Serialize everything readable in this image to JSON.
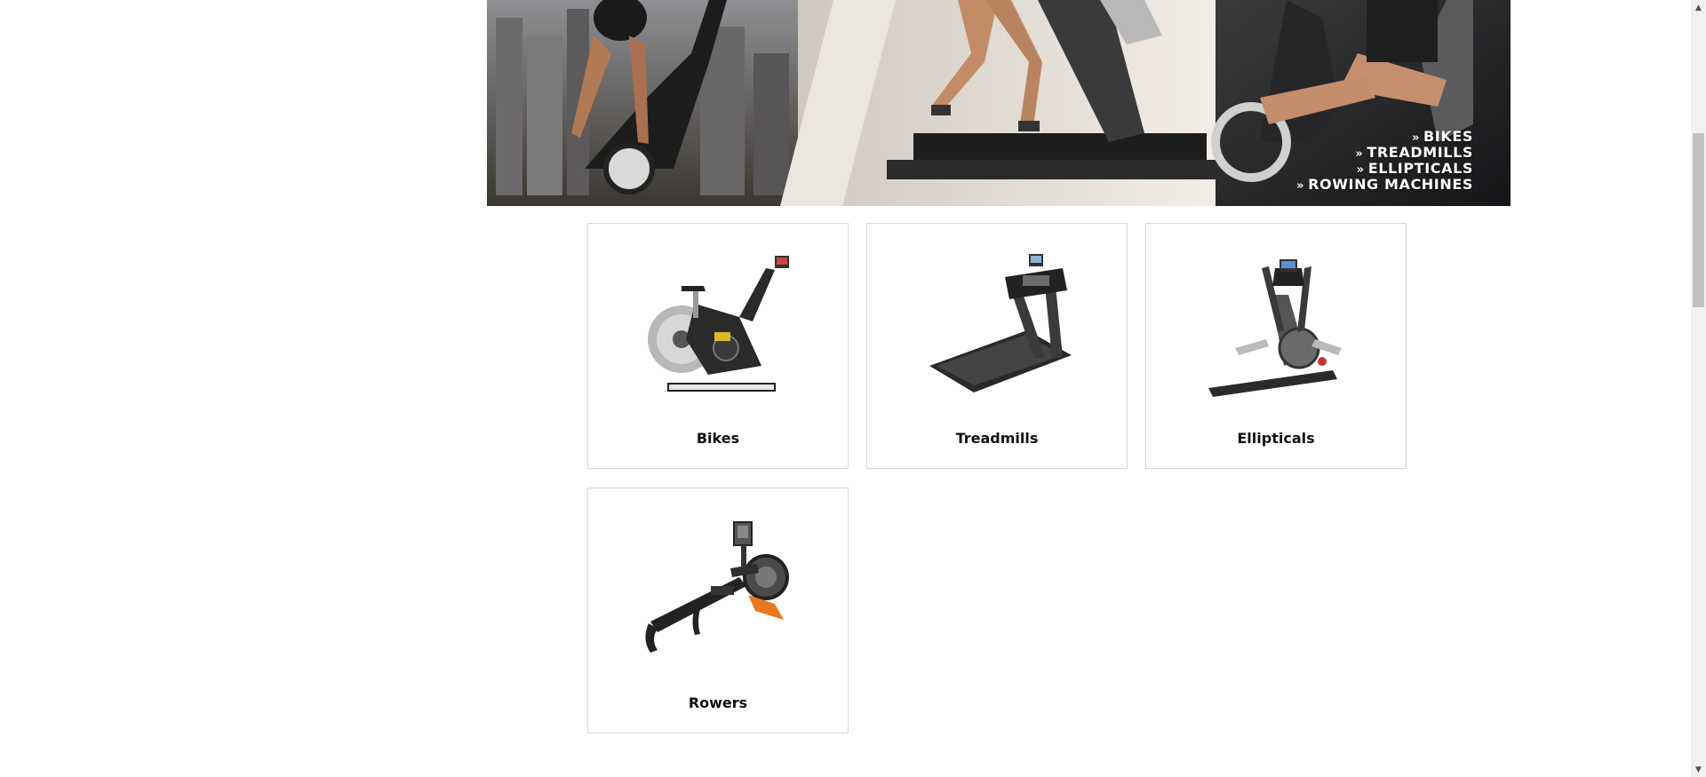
{
  "hero": {
    "links": [
      "BIKES",
      "TREADMILLS",
      "ELLIPTICALS",
      "ROWING MACHINES"
    ],
    "chevron": "»"
  },
  "categories": [
    {
      "label": "Bikes",
      "icon": "exercise-bike-icon"
    },
    {
      "label": "Treadmills",
      "icon": "treadmill-icon"
    },
    {
      "label": "Ellipticals",
      "icon": "elliptical-icon"
    },
    {
      "label": "Rowers",
      "icon": "rower-icon"
    }
  ],
  "scrollbar": {
    "up_glyph": "▲",
    "down_glyph": "▼"
  },
  "colors": {
    "accent_orange": "#e8781e",
    "card_border": "#d6d6d6"
  }
}
